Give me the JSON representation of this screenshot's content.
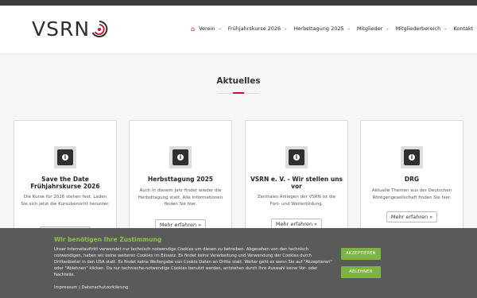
{
  "header": {
    "logo_text": "VSRN",
    "nav": [
      {
        "label": "Verein"
      },
      {
        "label": "Frühjahrskurse 2026"
      },
      {
        "label": "Herbsttagung 2025"
      },
      {
        "label": "Mitglieder"
      },
      {
        "label": "Mitgliederbereich"
      },
      {
        "label": "Kontakt"
      }
    ],
    "chevron": "⌄",
    "home_icon": "⌂"
  },
  "main": {
    "section_title": "Aktuelles",
    "cards": [
      {
        "title": "Save the Date Frühjahrskurse 2026",
        "text": "Die Kurse für 2026 stehen fest. Laden Sie sich jetzt die Kursübersicht herunter.",
        "button": ""
      },
      {
        "title": "Herbsttagung 2025",
        "text": "Auch in diesem Jahr findet wieder die Herbsttagung statt. Alle Informationen finden Sie hier.",
        "button": "Mehr erfahren »"
      },
      {
        "title": "VSRN e. V. - Wir stellen uns vor",
        "text": "Zentrales Anliegen der VSRN ist die Fort- und Weiterbildung.",
        "button": "Mehr erfahren »"
      },
      {
        "title": "DRG",
        "text": "Aktuelle Themen aus der Deutschen Röntgengesellschaft finden Sie hier.",
        "button": "Mehr erfahren »"
      }
    ],
    "icon_glyph": "i"
  },
  "cookie": {
    "title": "Wir benötigen Ihre Zustimmung",
    "text": "Unser Internetauftritt verwendet nur technisch notwendige Cookies um diesen zu betreiben. Abgesehen von den technisch notwendigen, haben wir keine weiteren Cookies im Einsatz. Es findet keine Verarbeitung und Verwendung der Cookies durch Drittanbieter in den USA statt. Es findet keine Weitergabe von Cookie Daten an Dritte statt. Weiter geht es wenn Sie auf \"Akzeptieren\" oder \"Ablehnen\" klicken. Da nur technische-notwendige Cookies benutzt werden, entstehen durch Ihre Auswahl keine Vor- oder Nachteile.",
    "links": "Impressum | Datenschutzerklärung",
    "accept": "AKZEPTIEREN",
    "decline": "ABLEHNEN"
  },
  "colors": {
    "accent": "#c8102e",
    "cookie_bg": "#5a5a5a",
    "cookie_title": "#8bc34a",
    "button_green": "#7cb342"
  }
}
